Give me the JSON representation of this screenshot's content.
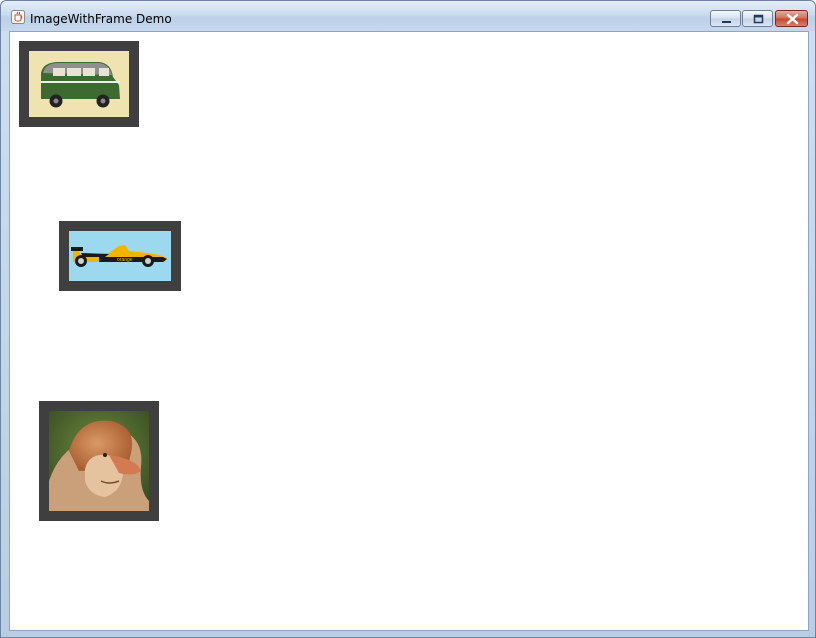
{
  "window": {
    "title": "ImageWithFrame Demo",
    "icon": "java-cup-icon",
    "controls": {
      "minimize": "minimize-icon",
      "maximize": "maximize-icon",
      "close": "close-icon"
    }
  },
  "images": [
    {
      "name": "green-van",
      "subject": "van",
      "colors": {
        "background": "#f0e3b2",
        "body": "#3d6a30",
        "roof": "#8f8f8f"
      }
    },
    {
      "name": "formula-one-car",
      "subject": "race car",
      "colors": {
        "background": "#9dd9ee",
        "body": "#f2b400"
      },
      "text": "orange"
    },
    {
      "name": "proboscis-monkey",
      "subject": "monkey",
      "colors": {
        "fur": "#c37442",
        "background": "#3e5a28"
      }
    }
  ],
  "colors": {
    "frame": "#3f3f3f",
    "content_background": "#ffffff"
  }
}
